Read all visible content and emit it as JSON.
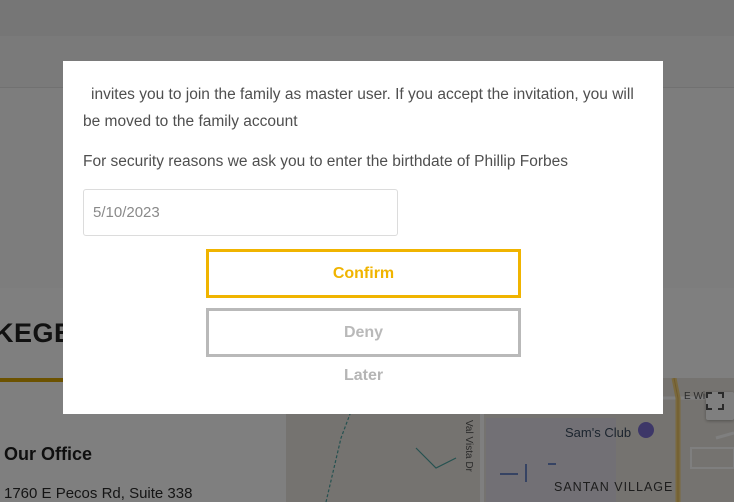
{
  "background": {
    "section_heading": "KEGE",
    "office_title": "Our Office",
    "office_address": "1760 E Pecos Rd, Suite 338",
    "map": {
      "labels": {
        "store": "Sam's Club",
        "neighborhood": "SANTAN VILLAGE",
        "street_vertical": "Val Vista Dr",
        "street_top": "E Wi"
      },
      "icons": [
        "store-pin-icon",
        "fullscreen-icon"
      ]
    }
  },
  "modal": {
    "invite_message": "invites you to join the family as master user. If you accept the invitation, you will be moved to the family account",
    "security_message": "For security reasons we ask you to enter the birthdate of Phillip Forbes",
    "birthdate_input": {
      "value": "5/10/2023"
    },
    "buttons": {
      "confirm": "Confirm",
      "deny": "Deny",
      "later": "Later"
    }
  },
  "colors": {
    "accent": "#f0b400",
    "deny_gray": "#b9b9b9",
    "text": "#4f4f4f",
    "overlay": "rgba(0,0,0,0.5)"
  }
}
